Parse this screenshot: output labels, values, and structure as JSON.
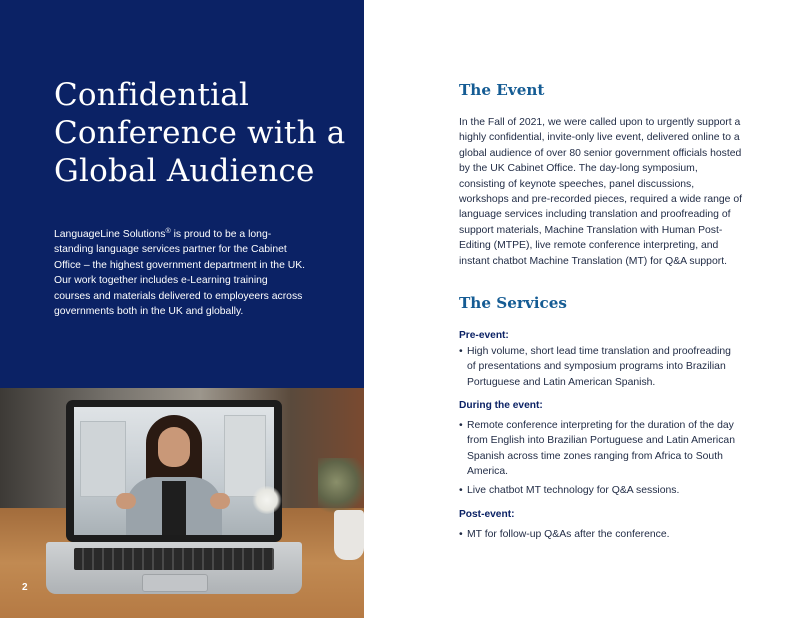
{
  "left": {
    "title_lines": [
      "Confidential",
      "Conference with a",
      "Global Audience"
    ],
    "intro_brand": "LanguageLine Solutions",
    "intro_mark": "®",
    "intro_text": " is proud to be a long-standing language services partner for the Cabinet Office – the highest government department in the UK. Our work together includes e-Learning training courses and materials delivered to employeers across governments both in the UK and globally.",
    "page_number": "2"
  },
  "event": {
    "heading": "The Event",
    "body": "In the Fall of 2021, we were called upon to urgently support a highly confidential, invite-only live event, delivered online to a global audience of over 80 senior government officials hosted by the UK Cabinet Office. The day-long symposium, consisting of keynote speeches, panel discussions, workshops and pre-recorded pieces, required a wide range of language services including translation and proofreading of support materials, Machine Translation with Human Post-Editing (MTPE), live remote conference interpreting, and instant chatbot Machine Translation (MT) for Q&A support."
  },
  "services": {
    "heading": "The Services",
    "bullet_glyph": "•",
    "groups": [
      {
        "label": "Pre-event:",
        "items": [
          "High volume, short lead time translation and proofreading of presentations and symposium programs into Brazilian Portuguese and Latin American Spanish."
        ]
      },
      {
        "label": "During the event:",
        "items": [
          "Remote conference interpreting for the duration of the day from English into Brazilian Portuguese and Latin American Spanish across time zones ranging from Africa to South America.",
          "Live chatbot MT technology for Q&A sessions."
        ]
      },
      {
        "label": "Post-event:",
        "items": [
          "MT for follow-up Q&As after the conference."
        ]
      }
    ]
  },
  "colors": {
    "navy": "#0b2265",
    "heading_blue": "#155c94",
    "body_text": "#1f2a44"
  }
}
